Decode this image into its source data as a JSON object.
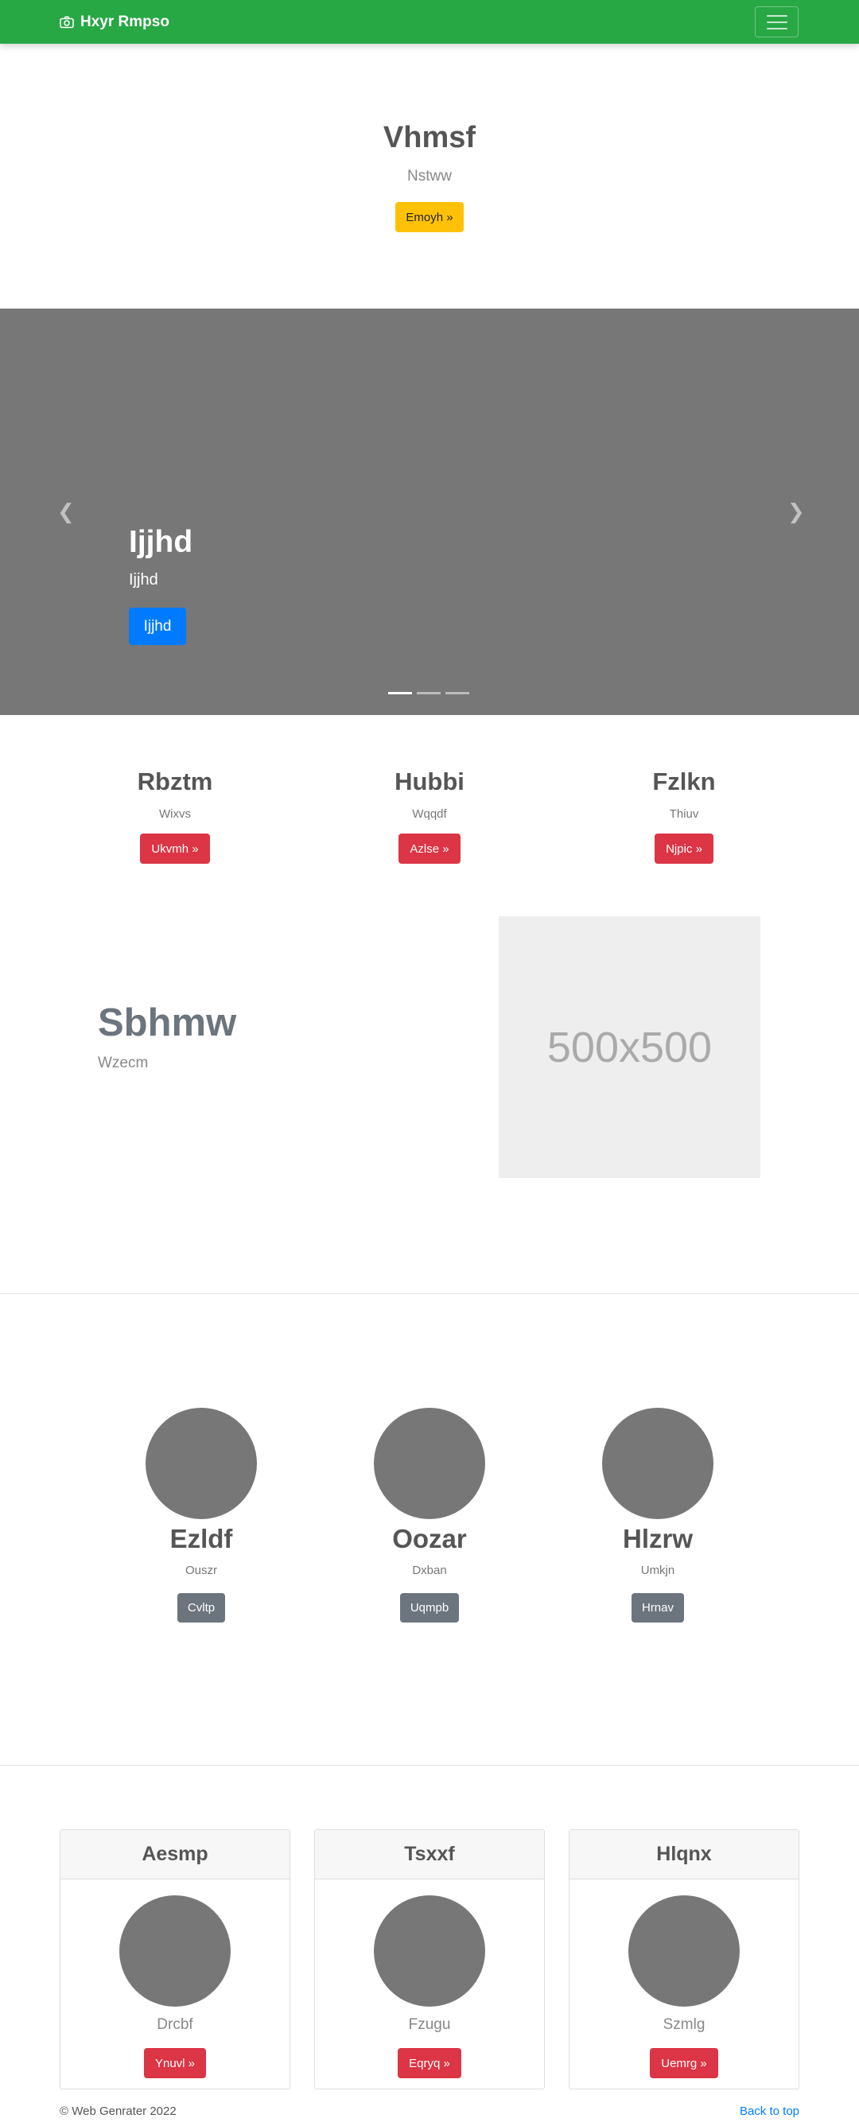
{
  "navbar": {
    "brand": "Hxyr Rmpso",
    "brand_icon": "camera-icon"
  },
  "hero": {
    "title": "Vhmsf",
    "subtitle": "Nstww",
    "button": "Emoyh »"
  },
  "carousel": {
    "title": "Ijjhd",
    "text": "Ijjhd",
    "button": "Ijjhd",
    "slides": 3,
    "active_slide": 1
  },
  "columns": [
    {
      "title": "Rbztm",
      "text": "Wixvs",
      "button": "Ukvmh »"
    },
    {
      "title": "Hubbi",
      "text": "Wqqdf",
      "button": "Azlse »"
    },
    {
      "title": "Fzlkn",
      "text": "Thiuv",
      "button": "Njpic »"
    }
  ],
  "feature": {
    "title": "Sbhmw",
    "subtitle": "Wzecm",
    "image_label": "500x500"
  },
  "team": [
    {
      "name": "Ezldf",
      "role": "Ouszr",
      "button": "Cvltp"
    },
    {
      "name": "Oozar",
      "role": "Dxban",
      "button": "Uqmpb"
    },
    {
      "name": "Hlzrw",
      "role": "Umkjn",
      "button": "Hrnav"
    }
  ],
  "cards": [
    {
      "title": "Aesmp",
      "name": "Drcbf",
      "button": "Ynuvl »"
    },
    {
      "title": "Tsxxf",
      "name": "Fzugu",
      "button": "Eqryq »"
    },
    {
      "title": "Hlqnx",
      "name": "Szmlg",
      "button": "Uemrg »"
    }
  ],
  "footer": {
    "copyright": "© Web Genrater 2022",
    "back_to_top": "Back to top"
  },
  "colors": {
    "navbar": "#28a745",
    "warning": "#ffc107",
    "primary": "#007bff",
    "danger": "#dc3545",
    "secondary": "#6c757d",
    "carousel_bg": "#777777"
  }
}
